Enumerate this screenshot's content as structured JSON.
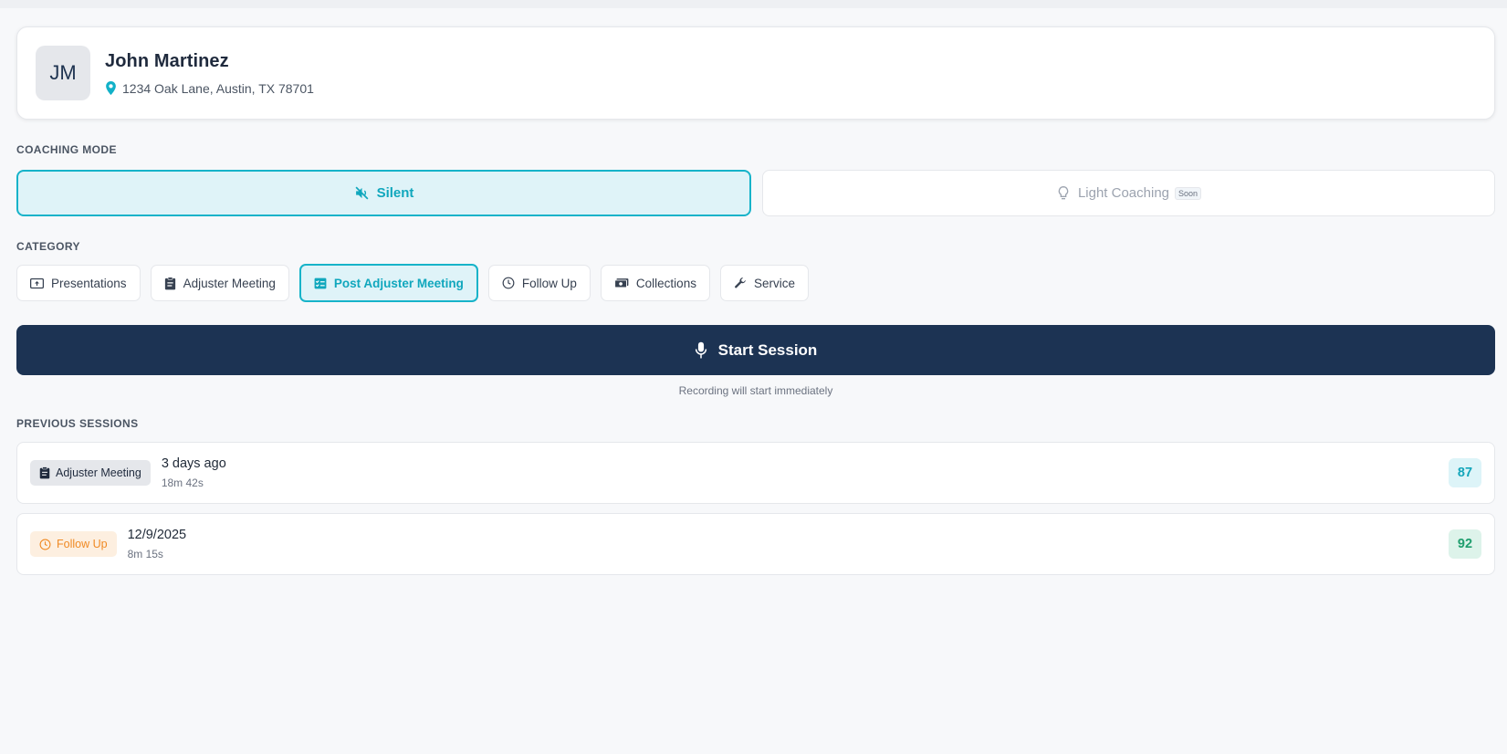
{
  "customer": {
    "initials": "JM",
    "name": "John Martinez",
    "address": "1234 Oak Lane, Austin, TX 78701",
    "icon": "map-pin-icon"
  },
  "coaching_mode": {
    "label": "COACHING MODE",
    "options": [
      {
        "label": "Silent",
        "icon": "speaker-muted-icon",
        "active": true
      },
      {
        "label": "Light Coaching",
        "icon": "lightbulb-icon",
        "badge": "Soon",
        "active": false
      }
    ]
  },
  "category": {
    "label": "CATEGORY",
    "items": [
      {
        "label": "Presentations",
        "icon": "presentation-icon",
        "active": false
      },
      {
        "label": "Adjuster Meeting",
        "icon": "clipboard-icon",
        "active": false
      },
      {
        "label": "Post Adjuster Meeting",
        "icon": "checklist-icon",
        "active": true
      },
      {
        "label": "Follow Up",
        "icon": "clock-icon",
        "active": false
      },
      {
        "label": "Collections",
        "icon": "cash-icon",
        "active": false
      },
      {
        "label": "Service",
        "icon": "wrench-icon",
        "active": false
      }
    ]
  },
  "start_session": {
    "label": "Start Session",
    "icon": "microphone-icon",
    "note": "Recording will start immediately"
  },
  "previous_sessions": {
    "label": "PREVIOUS SESSIONS",
    "items": [
      {
        "category": "Adjuster Meeting",
        "icon": "clipboard-icon",
        "when": "3 days ago",
        "duration": "18m 42s",
        "score": "87"
      },
      {
        "category": "Follow Up",
        "icon": "clock-icon",
        "when": "12/9/2025",
        "duration": "8m 15s",
        "score": "92"
      }
    ]
  },
  "colors": {
    "accent": "#17b3c9",
    "primary_button": "#1c3353",
    "follow_up_tag": "#f08a24",
    "score_teal": "#13a5ba",
    "score_green": "#1f9e6e"
  }
}
